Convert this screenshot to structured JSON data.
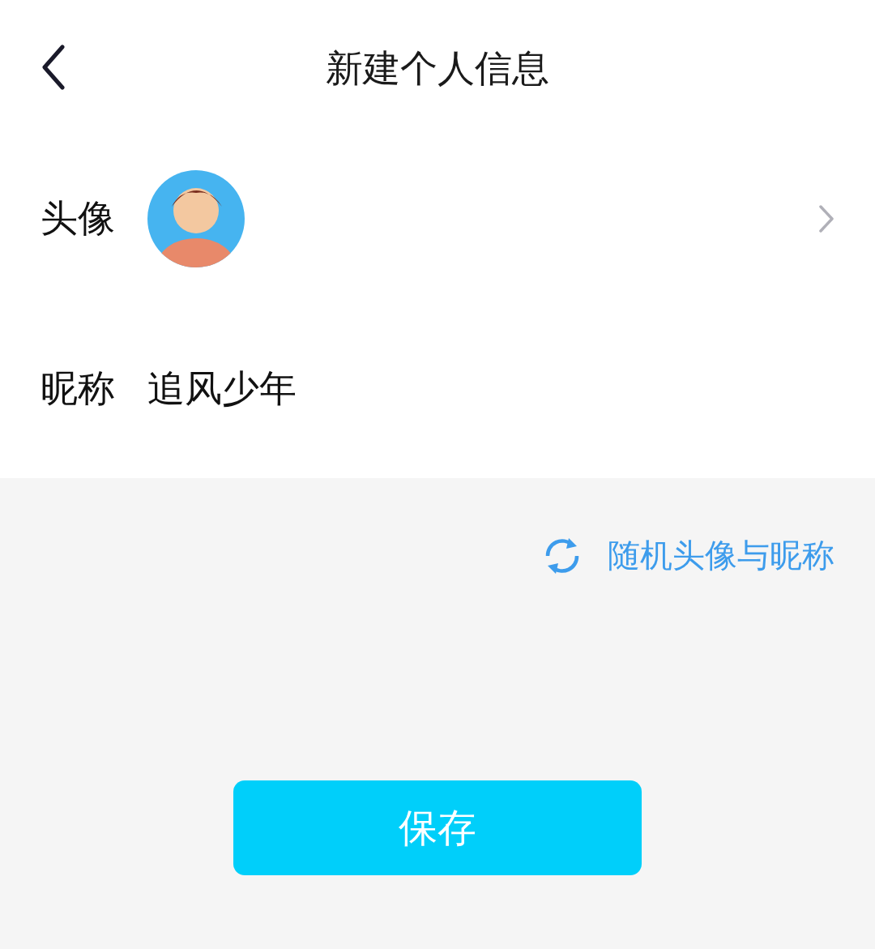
{
  "header": {
    "title": "新建个人信息"
  },
  "avatar_row": {
    "label": "头像"
  },
  "nickname_row": {
    "label": "昵称",
    "value": "追风少年"
  },
  "random_link": {
    "label": "随机头像与昵称"
  },
  "save_button": {
    "label": "保存"
  }
}
